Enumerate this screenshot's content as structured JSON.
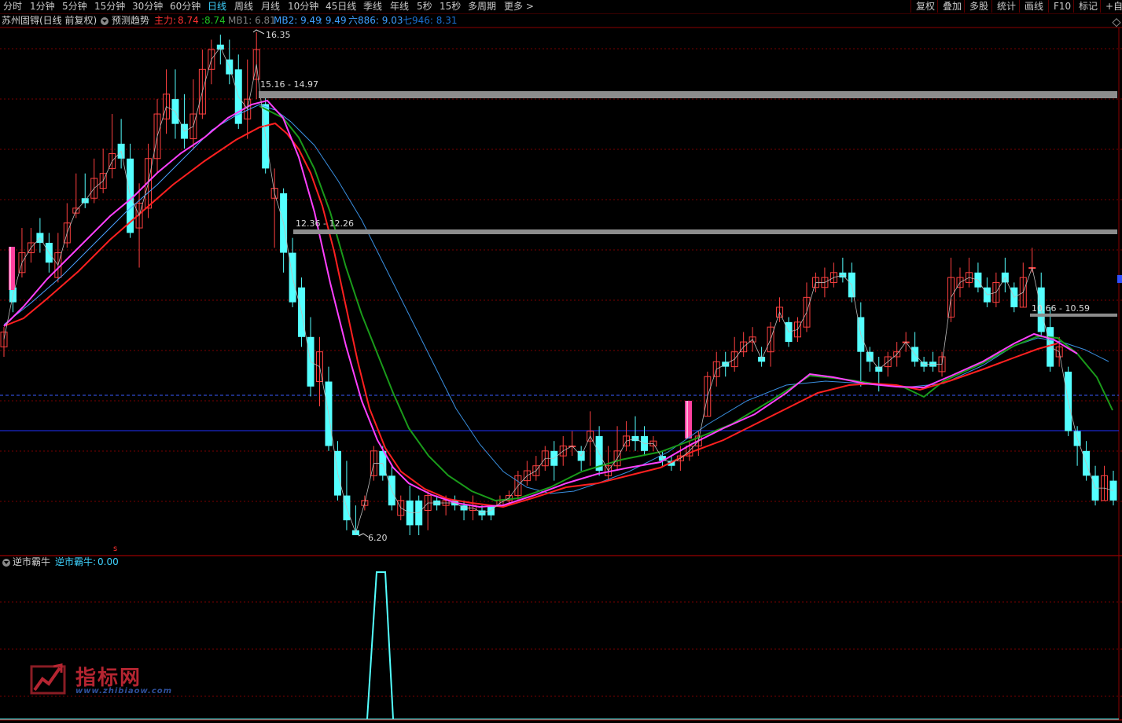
{
  "toolbar": {
    "periods": [
      "分时",
      "1分钟",
      "5分钟",
      "15分钟",
      "30分钟",
      "60分钟",
      "日线",
      "周线",
      "月线",
      "10分钟",
      "45日线",
      "季线",
      "年线",
      "5秒",
      "15秒",
      "多周期",
      "更多 >"
    ],
    "active_period": "日线",
    "right_buttons": [
      "复权",
      "叠加",
      "多股",
      "统计",
      "画线",
      "F10",
      "标记",
      "+自"
    ]
  },
  "info": {
    "stock": "苏州固锝(日线 前复权)",
    "indicator": "预测趋势",
    "main_label": "主力:",
    "main_v1": "8.74",
    "main_v2": ":8.74",
    "mb1": "MB1: 6.81",
    "mb2": "MB2: 9.49",
    "mb2b": ": 9.49",
    "six": "六886: 9.03",
    "seven": "七946: 8.31"
  },
  "annotations": {
    "high": "16.35",
    "low": "6.20",
    "resistance1": "15.16 - 14.97",
    "resistance2": "12.36 - 12.26",
    "resistance3": "10.66 - 10.59",
    "signal_mark": "s"
  },
  "sub": {
    "name": "逆市霸牛",
    "label": "逆市霸牛:",
    "value": "0.00"
  },
  "watermark": {
    "text": "指标网",
    "url": "www.zhibiaow.com"
  },
  "colors": {
    "up": "#ff4040",
    "down": "#54ffff",
    "ma_magenta": "#ff40ff",
    "ma_red": "#ff2020",
    "ma_green": "#1a9a1a",
    "ma_blue": "#3a8fe0",
    "grid": "#7a0000",
    "level_bar": "#8c8c8c"
  }
}
